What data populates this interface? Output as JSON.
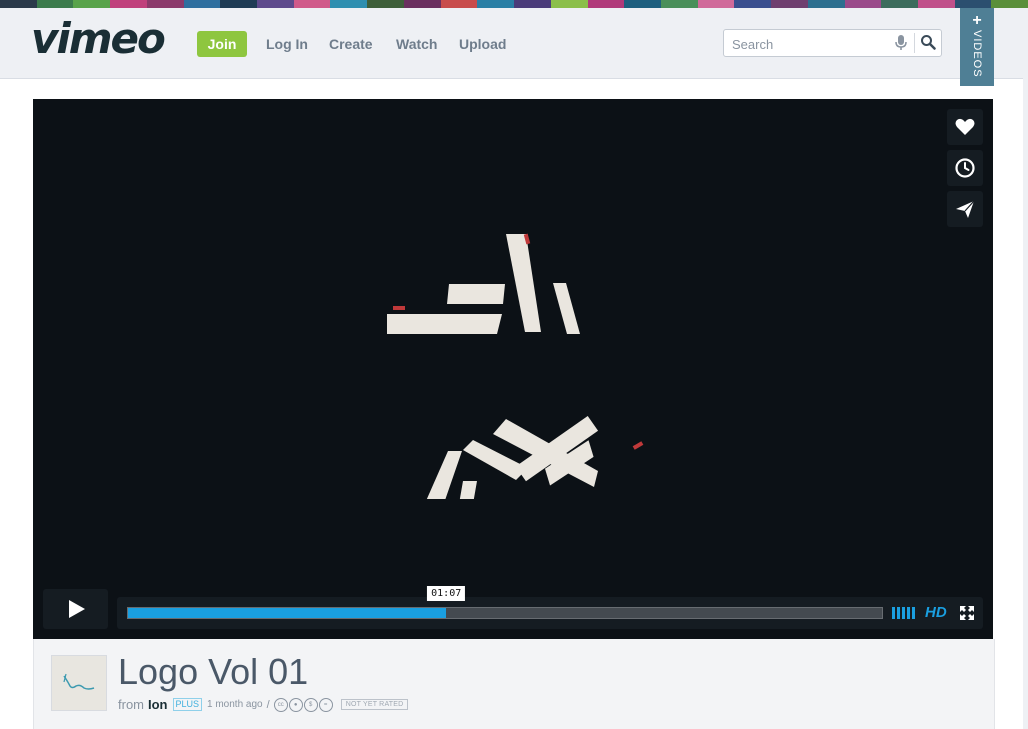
{
  "colors": {
    "strip": [
      "#2b3a4a",
      "#3b7b4c",
      "#58a34a",
      "#c0407c",
      "#8b3a6b",
      "#2f6f9f",
      "#1f3c55",
      "#5e4a8c",
      "#d05a8a",
      "#2f8fb0",
      "#3e5f3a",
      "#6a2f5f",
      "#c84c4c",
      "#2a7fa5",
      "#4b3c7a",
      "#8bbf4a",
      "#b03a7a",
      "#1e5f7f",
      "#4a8f5a",
      "#d06a9a",
      "#3a4f8f",
      "#6f3f6f",
      "#2d6f8f",
      "#9a4a8a",
      "#3c6c5c",
      "#c0508a",
      "#2b4f6f",
      "#5a8f3a"
    ],
    "accent_blue": "#1a9fe0",
    "join_green": "#8ec63f",
    "videos_tab": "#4f7f95",
    "player_bg": "#0c1116"
  },
  "header": {
    "logo": "vimeo",
    "join_label": "Join",
    "nav": [
      "Log In",
      "Create",
      "Watch",
      "Upload"
    ],
    "search": {
      "placeholder": "Search",
      "icon": "search-icon",
      "mic": "microphone-icon"
    },
    "videos_tab": {
      "plus": "+",
      "label": "VIDEOS"
    }
  },
  "player": {
    "side_buttons": [
      "heart-icon",
      "clock-icon",
      "paper-plane-icon"
    ],
    "play_icon": "play-icon",
    "progress": 0.422,
    "time_tip": "01:07",
    "hd_label": "HD",
    "volume_icon": "volume-icon",
    "fullscreen_icon": "fullscreen-icon"
  },
  "video": {
    "title": "Logo Vol 01",
    "from": "from",
    "author": "Ion",
    "badge": "PLUS",
    "time_ago": "1 month ago",
    "separator": "/",
    "license_icons": [
      "cc-icon",
      "by-icon",
      "nc-icon",
      "nd-icon"
    ],
    "rating": "NOT YET RATED"
  }
}
